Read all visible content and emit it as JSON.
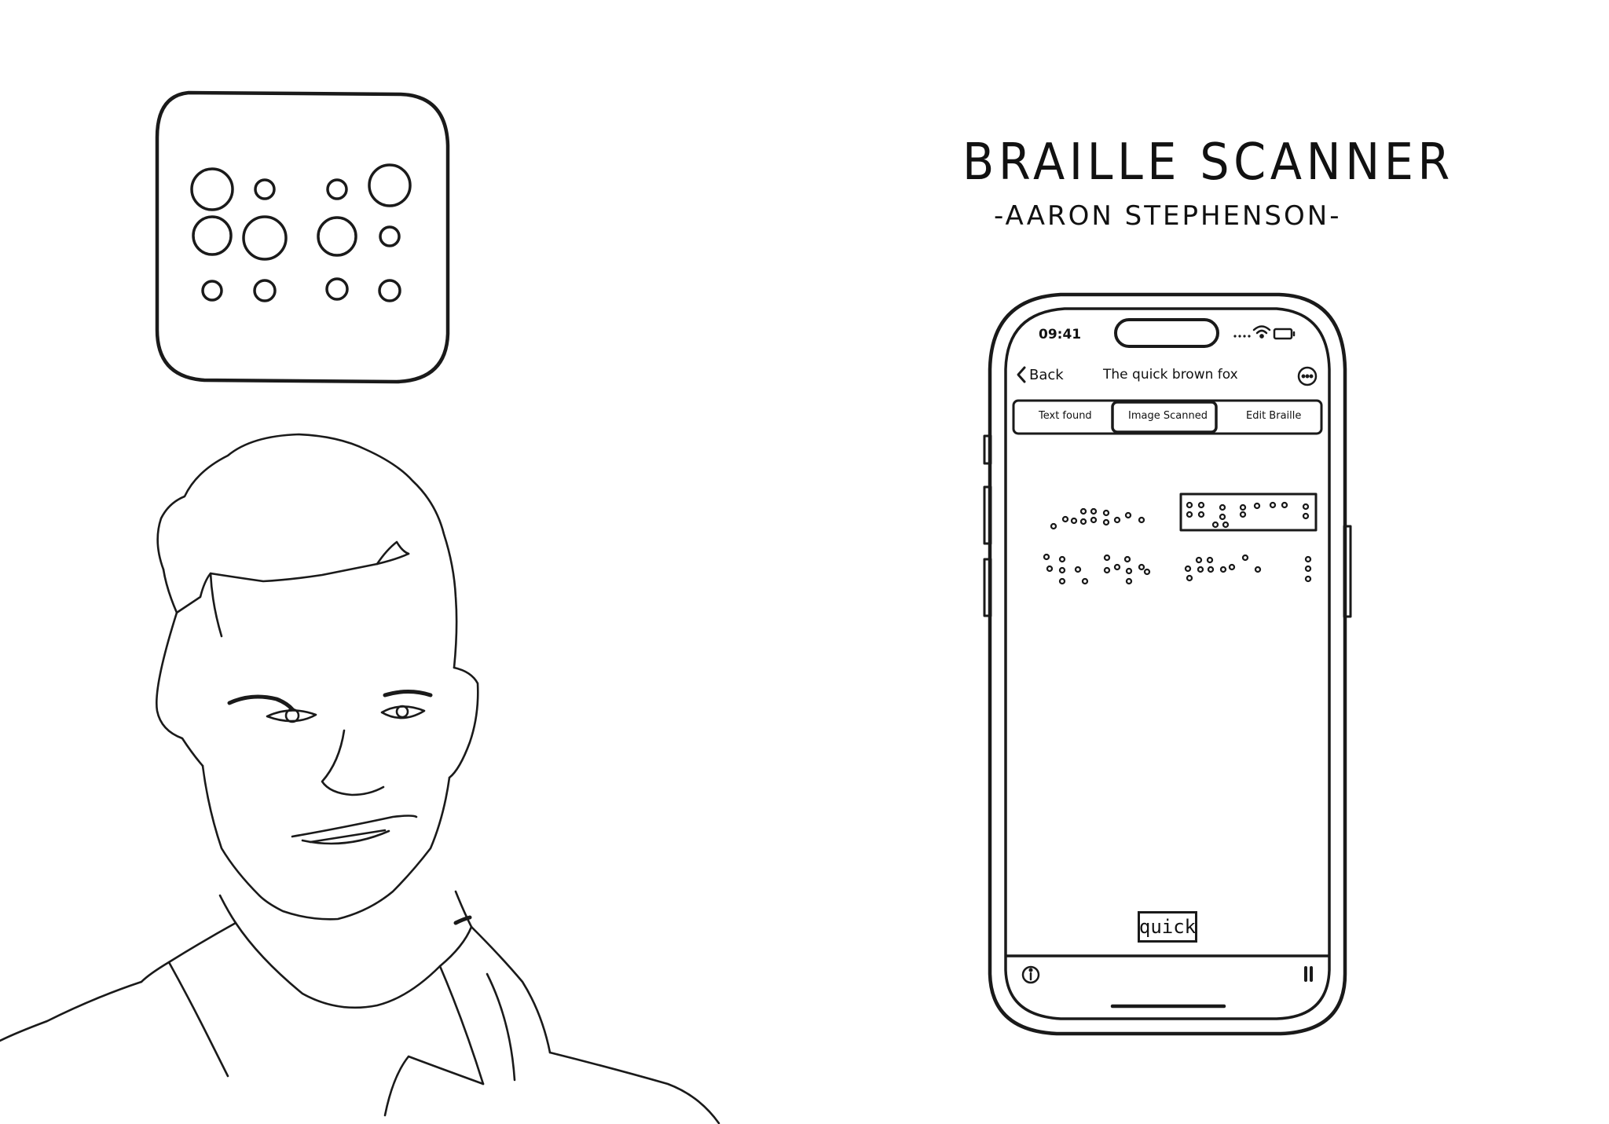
{
  "header": {
    "title": "BRAILLE SCANNER",
    "author": "-AARON STEPHENSON-"
  },
  "phone": {
    "status_time": "09:41",
    "nav": {
      "back_label": "Back",
      "title": "The quick brown fox"
    },
    "segments": [
      {
        "label": "Text found",
        "selected": false
      },
      {
        "label": "Image Scanned",
        "selected": true
      },
      {
        "label": "Edit Braille",
        "selected": false
      }
    ],
    "highlighted_word": "quick",
    "icons": {
      "info": "info-icon",
      "pause": "pause-icon",
      "more": "more-icon",
      "wifi": "wifi-icon",
      "battery": "battery-icon",
      "back": "chevron-left-icon"
    }
  },
  "app_icon": "braille-dots-icon",
  "portrait": "portrait-sketch"
}
